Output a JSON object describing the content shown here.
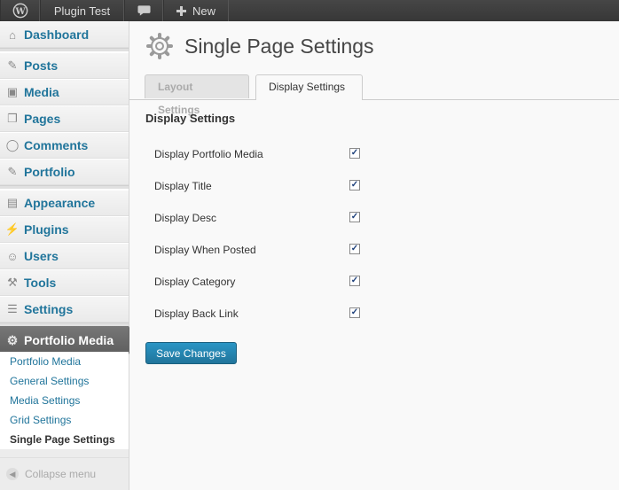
{
  "adminbar": {
    "site_name": "Plugin Test",
    "new_label": "New",
    "icons": [
      "wordpress-icon",
      "comment-icon",
      "plus-icon"
    ]
  },
  "sidebar": {
    "items": [
      {
        "label": "Dashboard",
        "icon": "dashboard-icon"
      },
      {
        "label": "Posts",
        "icon": "pin-icon"
      },
      {
        "label": "Media",
        "icon": "media-icon"
      },
      {
        "label": "Pages",
        "icon": "pages-icon"
      },
      {
        "label": "Comments",
        "icon": "comment-icon"
      },
      {
        "label": "Portfolio",
        "icon": "pin-icon"
      },
      {
        "label": "Appearance",
        "icon": "appearance-icon"
      },
      {
        "label": "Plugins",
        "icon": "plugins-icon"
      },
      {
        "label": "Users",
        "icon": "users-icon"
      },
      {
        "label": "Tools",
        "icon": "tools-icon"
      },
      {
        "label": "Settings",
        "icon": "settings-icon"
      }
    ],
    "active": {
      "label": "Portfolio Media",
      "icon": "gear-icon"
    },
    "submenu": [
      {
        "label": "Portfolio Media",
        "current": false
      },
      {
        "label": "General Settings",
        "current": false
      },
      {
        "label": "Media Settings",
        "current": false
      },
      {
        "label": "Grid Settings",
        "current": false
      },
      {
        "label": "Single Page Settings",
        "current": true
      }
    ],
    "collapse_label": "Collapse menu"
  },
  "main": {
    "title": "Single Page Settings",
    "tabs": [
      {
        "label": "Layout Settings",
        "active": false
      },
      {
        "label": "Display Settings",
        "active": true
      }
    ],
    "section_title": "Display Settings",
    "options": [
      {
        "label": "Display Portfolio Media",
        "checked": true
      },
      {
        "label": "Display Title",
        "checked": true
      },
      {
        "label": "Display Desc",
        "checked": true
      },
      {
        "label": "Display When Posted",
        "checked": true
      },
      {
        "label": "Display Category",
        "checked": true
      },
      {
        "label": "Display Back Link",
        "checked": true
      }
    ],
    "save_label": "Save Changes"
  },
  "colors": {
    "link": "#21759b",
    "adminbar_bg": "#464646",
    "active_menu_bg": "#6d6d6d",
    "button_bg": "#21759b"
  }
}
